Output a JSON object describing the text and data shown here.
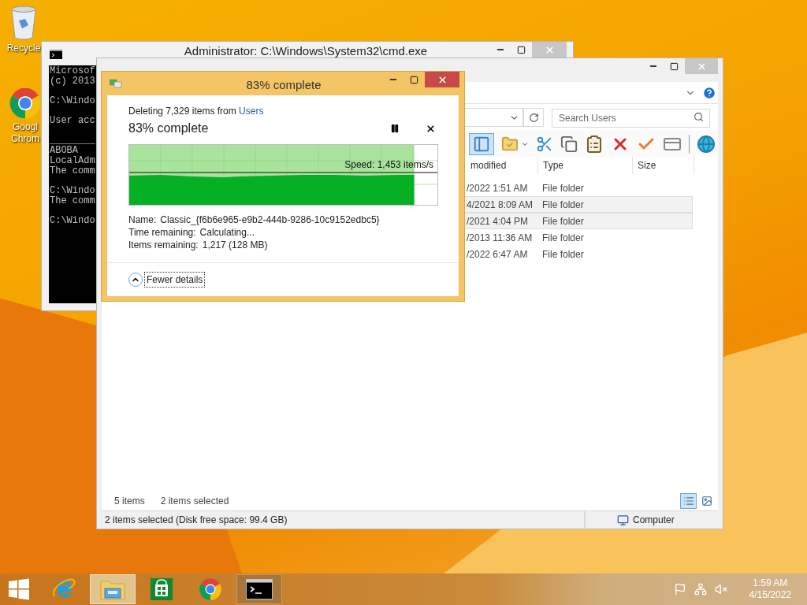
{
  "desktop_icons": [
    {
      "kind": "recycle-bin",
      "lines": [
        "Recycle"
      ]
    },
    {
      "kind": "chrome",
      "lines": [
        "Googl",
        "Chrom"
      ]
    }
  ],
  "cmd_window": {
    "title": "Administrator: C:\\Windows\\System32\\cmd.exe",
    "groups": [
      {
        "lines": [
          "Microsof",
          "(c) 2013"
        ]
      },
      {
        "lines": [
          "C:\\Windo"
        ]
      },
      {
        "lines": [
          "User acc"
        ]
      },
      {
        "rule": "________",
        "lines": [
          "ABOBA",
          "LocalAdm",
          "The comm"
        ]
      },
      {
        "lines": [
          "C:\\Windo",
          "The comm"
        ]
      },
      {
        "lines": [
          "C:\\Windo"
        ]
      }
    ]
  },
  "explorer": {
    "search_placeholder": "Search Users",
    "columns": [
      {
        "label": "modified"
      },
      {
        "label": "Type"
      },
      {
        "label": "Size"
      }
    ],
    "rows": [
      {
        "date": "/2022 1:51 AM",
        "type": "File folder",
        "selected": false
      },
      {
        "date": "4/2021 8:09 AM",
        "type": "File folder",
        "selected": true
      },
      {
        "date": "/2021 4:04 PM",
        "type": "File folder",
        "selected": true
      },
      {
        "date": "/2013 11:36 AM",
        "type": "File folder",
        "selected": false
      },
      {
        "date": "/2022 6:47 AM",
        "type": "File folder",
        "selected": false
      }
    ],
    "item_count": "5 items",
    "selected_count": "2 items selected",
    "view_buttons": [
      {
        "kind": "details",
        "selected": true
      },
      {
        "kind": "tiles",
        "selected": false
      }
    ],
    "status": "2 items selected (Disk free space: 99.4 GB)",
    "location": "Computer"
  },
  "progress_dialog": {
    "title": "83% complete",
    "source": "Deleting 7,329 items from",
    "source_link": "Users",
    "heading": "83% complete",
    "speed": "Speed: 1,453 items/s",
    "level": 0.92,
    "details": [
      {
        "label": "Name:",
        "value": "Classic_{f6b6e965-e9b2-444b-9286-10c9152edbc5}"
      },
      {
        "label": "Time remaining:",
        "value": "Calculating..."
      },
      {
        "label": "Items remaining:",
        "value": "1,217 (128 MB)"
      }
    ],
    "toggle": "Fewer details"
  },
  "taskbar": {
    "apps": [
      {
        "kind": "ie",
        "running": false,
        "focused": false
      },
      {
        "kind": "explorer",
        "running": true,
        "focused": true
      },
      {
        "kind": "store",
        "running": false,
        "focused": false
      },
      {
        "kind": "chrome",
        "running": false,
        "focused": false
      },
      {
        "kind": "cmd",
        "running": true,
        "focused": false
      }
    ],
    "tray": [
      {
        "kind": "flag"
      },
      {
        "kind": "network"
      },
      {
        "kind": "volume-muted"
      }
    ],
    "time": "1:59 AM",
    "date": "4/15/2022"
  }
}
